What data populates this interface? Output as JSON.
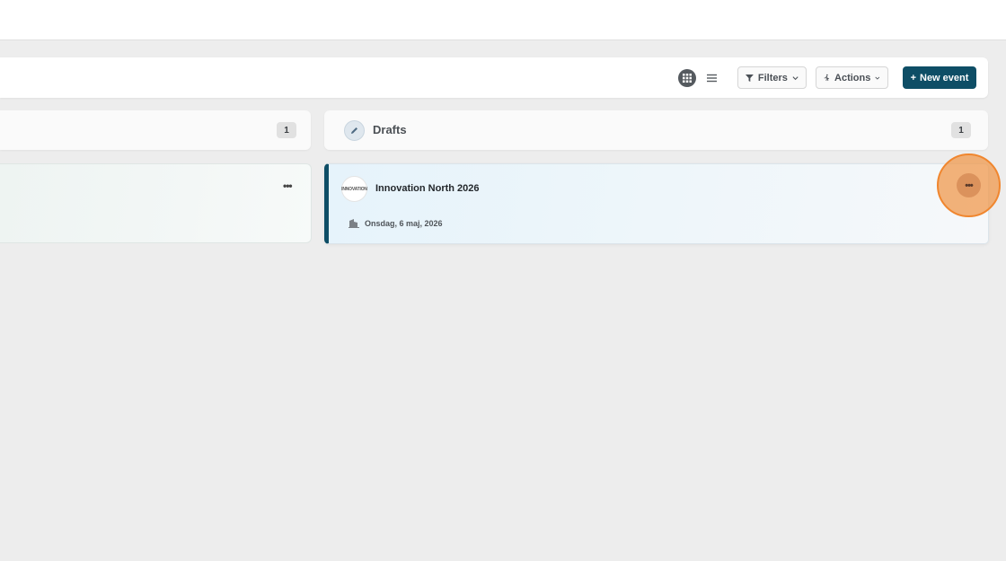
{
  "toolbar": {
    "filters_label": "Filters",
    "actions_label": "Actions",
    "new_event_label": "New event",
    "new_event_prefix": "+"
  },
  "columns": [
    {
      "title": "",
      "count": "1"
    },
    {
      "title": "Drafts",
      "count": "1"
    }
  ],
  "cards": [
    {
      "logo_text": "INNOVATION",
      "title": "Innovation North 2026",
      "date": "Onsdag, 6 maj, 2026",
      "menu": "•••"
    }
  ],
  "left_card": {
    "menu": "•••"
  },
  "colors": {
    "primary": "#0e4e66",
    "highlight": "#f0862e",
    "background": "#ededed"
  },
  "icons": {
    "grid_view": "grid-icon",
    "list_view": "list-icon",
    "filter": "filter-icon",
    "actions": "walking-person-icon",
    "edit": "pencil-icon",
    "venue": "building-icon"
  }
}
